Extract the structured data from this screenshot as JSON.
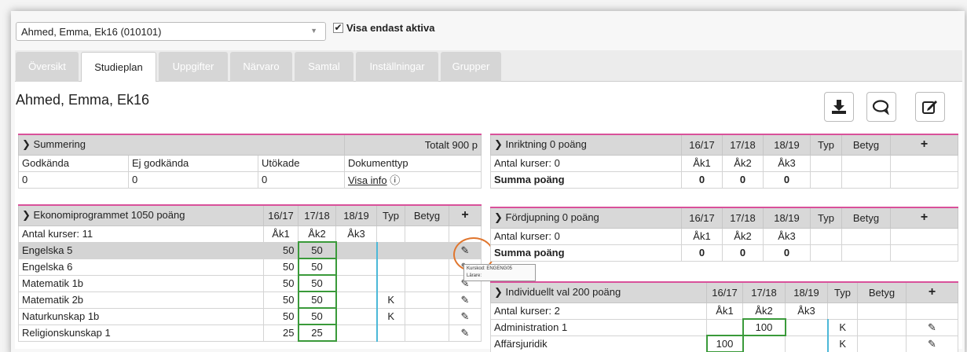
{
  "student_select": {
    "value": "Ahmed, Emma, Ek16 (010101)"
  },
  "active_only": {
    "label": "Visa endast aktiva",
    "checked": true
  },
  "tabs": [
    "Översikt",
    "Studieplan",
    "Uppgifter",
    "Närvaro",
    "Samtal",
    "Inställningar",
    "Grupper"
  ],
  "page_title": "Ahmed, Emma, Ek16",
  "icons": {
    "download": "download-icon",
    "comment": "comment-icon",
    "edit": "edit-icon"
  },
  "summering": {
    "title": "Summering",
    "total": "Totalt 900 p",
    "headers": [
      "Godkända",
      "Ej godkända",
      "Utökade",
      "Dokumenttyp"
    ],
    "values": [
      "0",
      "0",
      "0"
    ],
    "info_link": "Visa info"
  },
  "program": {
    "title": "Ekonomiprogrammet 1050 poäng",
    "cols": [
      "16/17",
      "17/18",
      "18/19",
      "Typ",
      "Betyg"
    ],
    "count_label": "Antal kurser: 11",
    "years": [
      "Åk1",
      "Åk2",
      "Åk3"
    ],
    "rows": [
      {
        "name": "Engelska 5",
        "y1": "50",
        "y2": "50",
        "typ": ""
      },
      {
        "name": "Engelska 6",
        "y1": "50",
        "y2": "50",
        "typ": ""
      },
      {
        "name": "Matematik 1b",
        "y1": "50",
        "y2": "50",
        "typ": ""
      },
      {
        "name": "Matematik 2b",
        "y1": "50",
        "y2": "50",
        "typ": "K"
      },
      {
        "name": "Naturkunskap 1b",
        "y1": "50",
        "y2": "50",
        "typ": "K"
      },
      {
        "name": "Religionskunskap 1",
        "y1": "25",
        "y2": "25",
        "typ": ""
      }
    ]
  },
  "tooltip": {
    "line1": "Kurskod: ENGENG05",
    "line2": "Lärare:"
  },
  "inriktning": {
    "title": "Inriktning 0 poäng",
    "cols": [
      "16/17",
      "17/18",
      "18/19",
      "Typ",
      "Betyg"
    ],
    "count_label": "Antal kurser: 0",
    "years": [
      "Åk1",
      "Åk2",
      "Åk3"
    ],
    "sum_label": "Summa poäng",
    "sums": [
      "0",
      "0",
      "0"
    ]
  },
  "fordjupning": {
    "title": "Fördjupning 0 poäng",
    "cols": [
      "16/17",
      "17/18",
      "18/19",
      "Typ",
      "Betyg"
    ],
    "count_label": "Antal kurser: 0",
    "years": [
      "Åk1",
      "Åk2",
      "Åk3"
    ],
    "sum_label": "Summa poäng",
    "sums": [
      "0",
      "0",
      "0"
    ]
  },
  "individuellt": {
    "title": "Individuellt val 200 poäng",
    "cols": [
      "16/17",
      "17/18",
      "18/19",
      "Typ",
      "Betyg"
    ],
    "count_label": "Antal kurser: 2",
    "years": [
      "Åk1",
      "Åk2",
      "Åk3"
    ],
    "rows": [
      {
        "name": "Administration 1",
        "y1": "",
        "y2": "100",
        "typ": "K"
      },
      {
        "name": "Affärsjuridik",
        "y1": "100",
        "y2": "",
        "typ": "K"
      }
    ]
  }
}
